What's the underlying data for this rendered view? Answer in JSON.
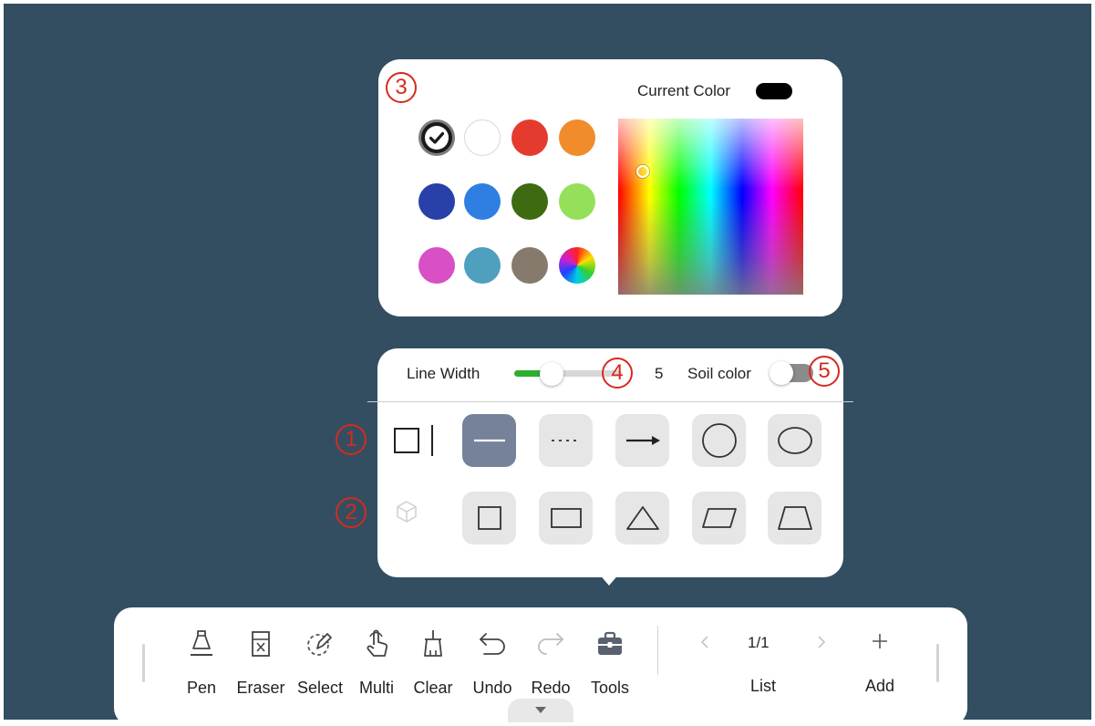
{
  "color_panel": {
    "callout": "3",
    "current_color_label": "Current Color",
    "current_color": "#000000",
    "swatches": [
      {
        "name": "black",
        "color": "#1a1a1a",
        "selected": true
      },
      {
        "name": "white",
        "color": "#ffffff",
        "selected": false
      },
      {
        "name": "red",
        "color": "#e53b2f",
        "selected": false
      },
      {
        "name": "orange",
        "color": "#f08c2b",
        "selected": false
      },
      {
        "name": "navy",
        "color": "#2840a8",
        "selected": false
      },
      {
        "name": "blue",
        "color": "#2f7fe3",
        "selected": false
      },
      {
        "name": "dark-green",
        "color": "#3e6b12",
        "selected": false
      },
      {
        "name": "light-green",
        "color": "#95e05a",
        "selected": false
      },
      {
        "name": "magenta",
        "color": "#d84fc6",
        "selected": false
      },
      {
        "name": "teal",
        "color": "#4f9fbf",
        "selected": false
      },
      {
        "name": "taupe",
        "color": "#857a6c",
        "selected": false
      },
      {
        "name": "custom-color-wheel",
        "color": "conic",
        "selected": false
      }
    ]
  },
  "shape_panel": {
    "line_width_label": "Line Width",
    "line_width_value": "5",
    "line_width_fraction": 0.3,
    "line_width_callout": "4",
    "solid_color_label": "Soil color",
    "solid_color_callout": "5",
    "solid_color_on": false,
    "row1_callout": "1",
    "row2_callout": "2",
    "row1_icons": [
      "rectangle-line-mode-icon",
      "line-icon",
      "dashed-line-icon",
      "arrow-icon",
      "circle-icon",
      "ellipse-icon"
    ],
    "row2_icons": [
      "cube-3d-icon",
      "square-icon",
      "rectangle-icon",
      "triangle-icon",
      "parallelogram-icon",
      "trapezoid-icon"
    ],
    "active_shape": "line-icon"
  },
  "toolbar": {
    "tools": [
      {
        "key": "pen",
        "label": "Pen",
        "icon": "pen-icon"
      },
      {
        "key": "eraser",
        "label": "Eraser",
        "icon": "eraser-icon"
      },
      {
        "key": "select",
        "label": "Select",
        "icon": "select-icon"
      },
      {
        "key": "multi",
        "label": "Multi",
        "icon": "multi-touch-icon"
      },
      {
        "key": "clear",
        "label": "Clear",
        "icon": "clear-icon"
      },
      {
        "key": "undo",
        "label": "Undo",
        "icon": "undo-icon"
      },
      {
        "key": "redo",
        "label": "Redo",
        "icon": "redo-icon"
      },
      {
        "key": "tools",
        "label": "Tools",
        "icon": "toolbox-icon"
      }
    ],
    "page_indicator": "1/1",
    "list_label": "List",
    "add_label": "Add",
    "prev_icon": "chevron-left-icon",
    "next_icon": "chevron-right-icon",
    "add_icon": "plus-icon",
    "expand_icon": "caret-down-icon"
  },
  "colors": {
    "board": "#334e61",
    "accent_green": "#2eae2e",
    "callout_red": "#d62a1e",
    "active_shape_bg": "#75829a"
  }
}
